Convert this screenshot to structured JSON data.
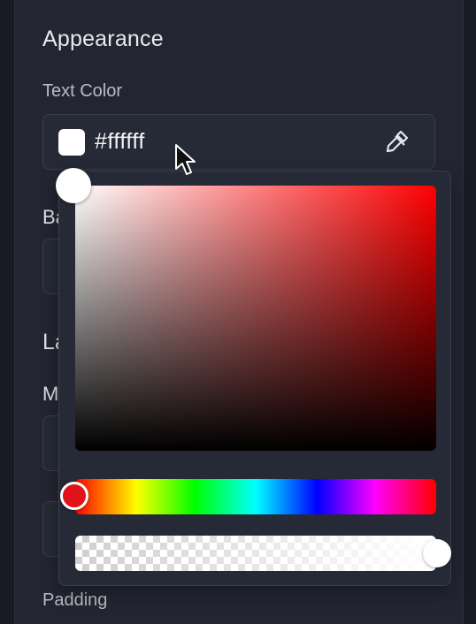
{
  "panel": {
    "section_title": "Appearance",
    "text_color_label": "Text Color",
    "text_color_value": "#ffffff",
    "background_label_partial": "Ba",
    "layout_title_partial": "La",
    "margin_label_partial": "M",
    "padding_label": "Padding"
  },
  "icons": {
    "eyedropper": "eyedropper-icon",
    "cursor": "mouse-pointer"
  },
  "color_picker": {
    "selected_color": "#ffffff",
    "hue_color": "#ff0000",
    "alpha_percent": 100
  }
}
